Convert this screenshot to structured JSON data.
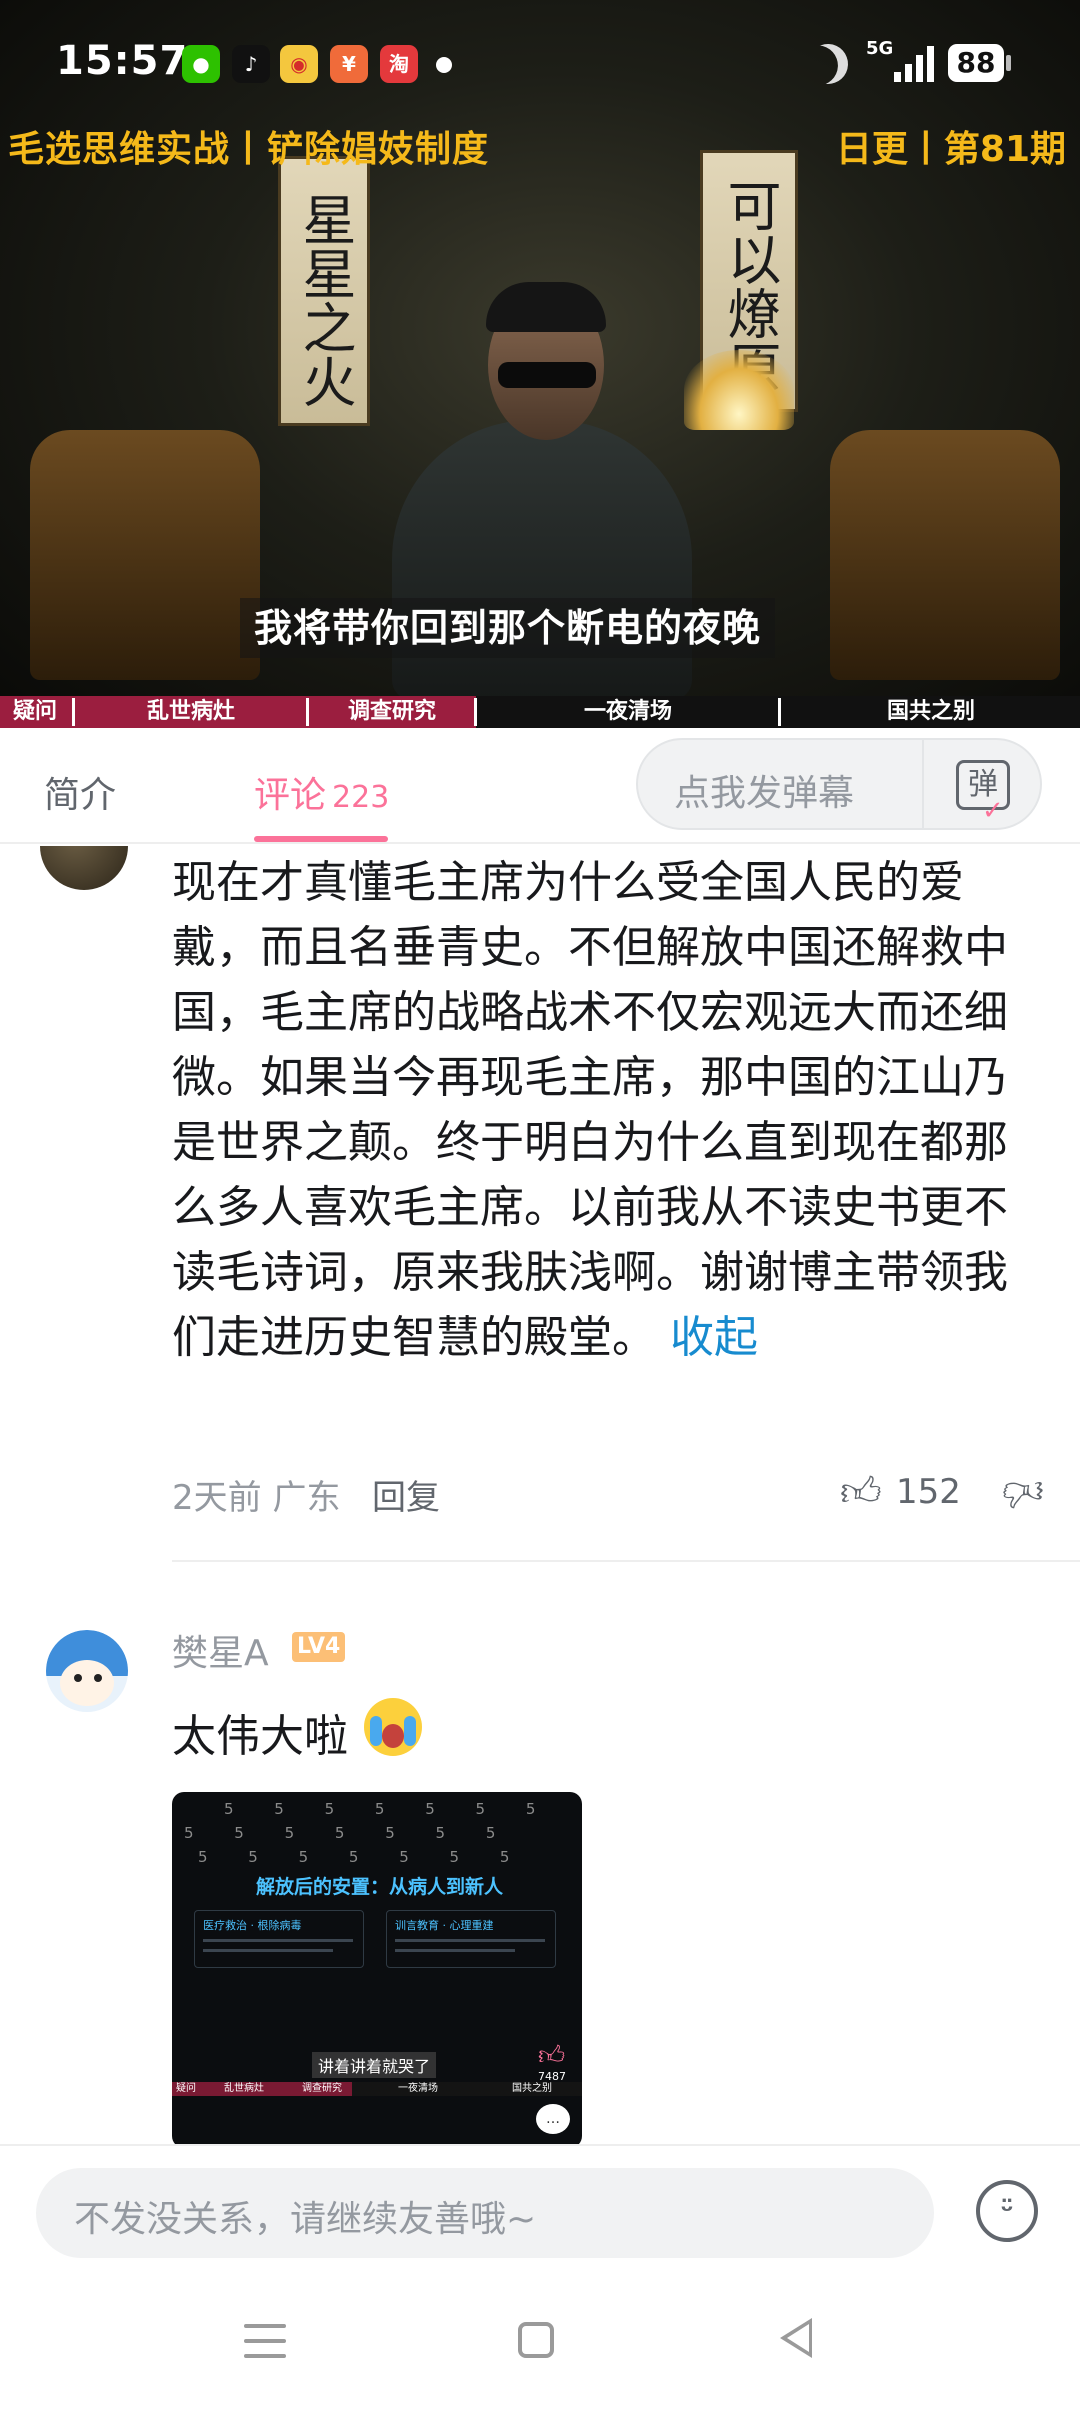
{
  "status": {
    "time": "15:57",
    "network": "5G",
    "battery": "88",
    "notification_icons": [
      "wechat-icon",
      "tiktok-icon",
      "weibo-icon",
      "taobao-flash-icon",
      "taobao-icon"
    ]
  },
  "video": {
    "overlay_left": "毛选思维实战丨铲除娼妓制度",
    "overlay_right": "日更丨第81期",
    "scroll_left": "星星之火",
    "scroll_right": "可以燎原",
    "subtitle": "我将带你回到那个断电的夜晚",
    "chapters": [
      "疑问",
      "乱世病灶",
      "调查研究",
      "一夜清场",
      "国共之别"
    ],
    "chapter_progress": 0.29
  },
  "tabs": {
    "intro": "简介",
    "comments": "评论",
    "comment_count": "223",
    "danmaku_placeholder": "点我发弹幕",
    "danmaku_button": "弹"
  },
  "comments": [
    {
      "text": "现在才真懂毛主席为什么受全国人民的爱戴，而且名垂青史。不但解放中国还解救中国，毛主席的战略战术不仅宏观远大而还细微。如果当今再现毛主席，那中国的江山乃是世界之颠。终于明白为什么直到现在都那么多人喜欢毛主席。以前我从不读史书更不读毛诗词，原来我肤浅啊。谢谢博主带领我们走进历史智慧的殿堂。",
      "collapse_label": "收起",
      "time_location": "2天前 广东",
      "reply_label": "回复",
      "likes": "152"
    },
    {
      "username": "樊星A",
      "level": "LV4",
      "text": "太伟大啦",
      "thumbnail": {
        "number_row": "5 5 5 5 5 5 5",
        "title": "解放后的安置：从病人到新人",
        "box_left_title": "医疗救治 · 根除病毒",
        "box_right_title": "训言教育 · 心理重建",
        "subtitle": "讲着讲着就哭了",
        "like_count": "7487",
        "chapters": [
          "疑问",
          "乱世病灶",
          "调查研究",
          "一夜清场",
          "国共之别"
        ]
      }
    }
  ],
  "input": {
    "placeholder": "不发没关系，请继续友善哦~"
  },
  "colors": {
    "accent_pink": "#fb7299",
    "link_blue": "#178bcf",
    "overlay_gold": "#f5b91a",
    "chapter_played": "#9b1e3f"
  }
}
